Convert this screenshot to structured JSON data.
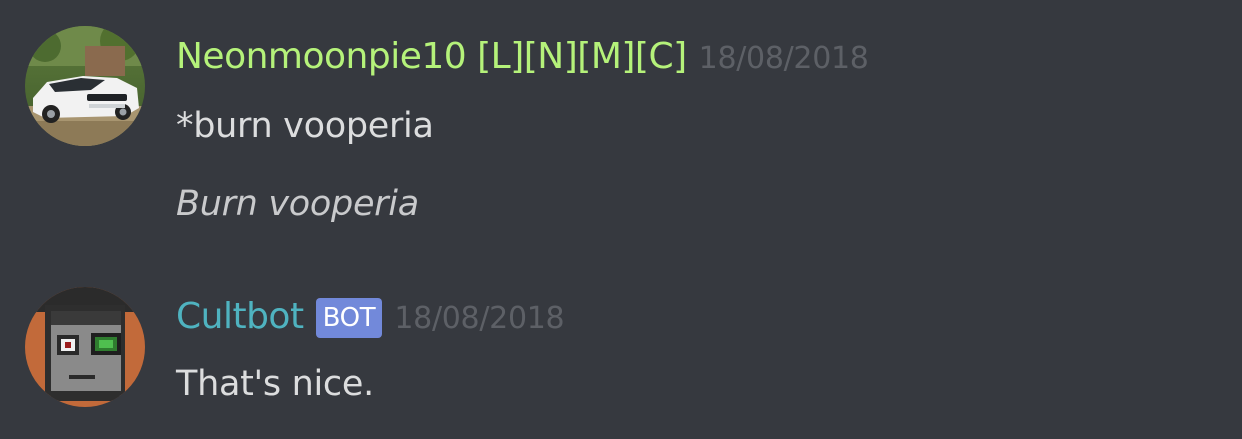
{
  "messages": [
    {
      "author": "Neonmoonpie10 [L][N][M][C]",
      "author_color": "#b5f27a",
      "timestamp": "18/08/2018",
      "avatar_icon": "car-avatar",
      "lines": [
        "*burn vooperia"
      ],
      "embed_italic": "Burn vooperia"
    },
    {
      "author": "Cultbot",
      "author_color": "#4fb3c0",
      "is_bot": true,
      "bot_tag": "BOT",
      "timestamp": "18/08/2018",
      "avatar_icon": "pixel-face-avatar",
      "lines": [
        "That's nice."
      ]
    }
  ]
}
